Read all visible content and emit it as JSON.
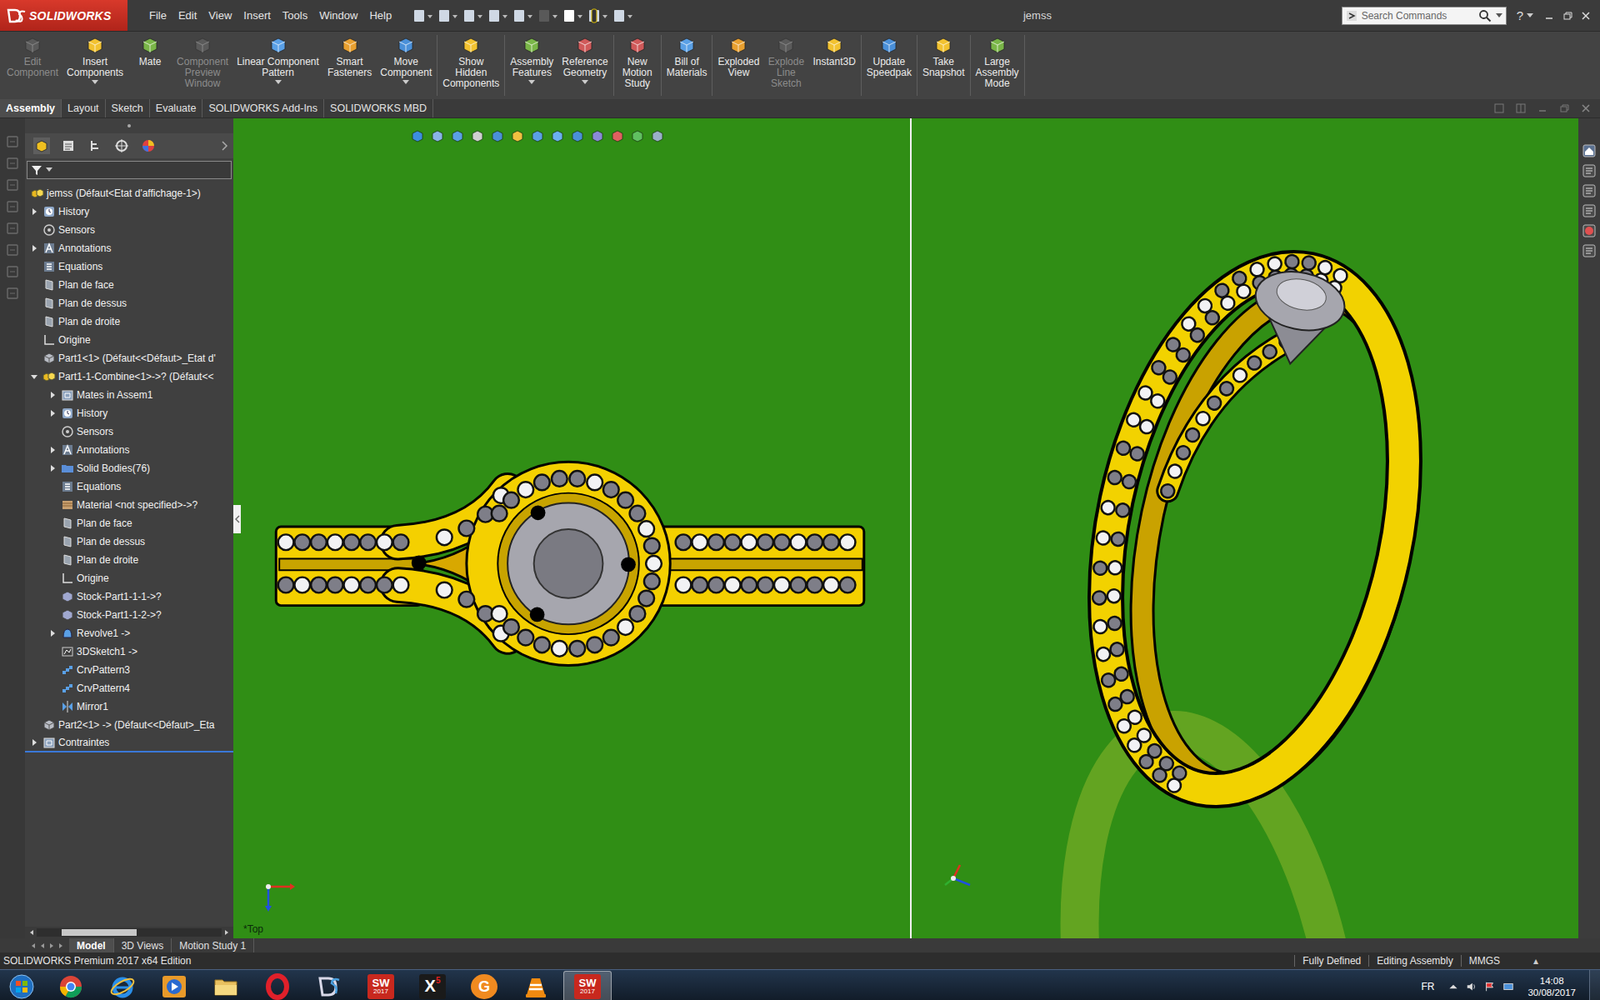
{
  "window": {
    "title": "jemss"
  },
  "brand": {
    "name": "SOLIDWORKS"
  },
  "menu": [
    "File",
    "Edit",
    "View",
    "Insert",
    "Tools",
    "Window",
    "Help"
  ],
  "search": {
    "placeholder": "Search Commands"
  },
  "help": {
    "label": "?"
  },
  "ribbon": {
    "groups": [
      [
        {
          "lines": [
            "Edit",
            "Component"
          ],
          "disabled": true,
          "dropdown": false
        },
        {
          "lines": [
            "Insert",
            "Components"
          ],
          "disabled": false,
          "dropdown": true
        },
        {
          "lines": [
            "Mate"
          ],
          "disabled": false,
          "dropdown": false
        },
        {
          "lines": [
            "Component",
            "Preview",
            "Window"
          ],
          "disabled": true,
          "dropdown": false
        },
        {
          "lines": [
            "Linear Component",
            "Pattern"
          ],
          "disabled": false,
          "dropdown": true
        },
        {
          "lines": [
            "Smart",
            "Fasteners"
          ],
          "disabled": false,
          "dropdown": false
        },
        {
          "lines": [
            "Move",
            "Component"
          ],
          "disabled": false,
          "dropdown": true
        }
      ],
      [
        {
          "lines": [
            "Show",
            "Hidden",
            "Components"
          ],
          "disabled": false,
          "dropdown": false
        }
      ],
      [
        {
          "lines": [
            "Assembly",
            "Features"
          ],
          "disabled": false,
          "dropdown": true
        },
        {
          "lines": [
            "Reference",
            "Geometry"
          ],
          "disabled": false,
          "dropdown": true
        }
      ],
      [
        {
          "lines": [
            "New",
            "Motion",
            "Study"
          ],
          "disabled": false,
          "dropdown": false
        }
      ],
      [
        {
          "lines": [
            "Bill of",
            "Materials"
          ],
          "disabled": false,
          "dropdown": false
        }
      ],
      [
        {
          "lines": [
            "Exploded",
            "View"
          ],
          "disabled": false,
          "dropdown": false
        },
        {
          "lines": [
            "Explode",
            "Line",
            "Sketch"
          ],
          "disabled": true,
          "dropdown": false
        },
        {
          "lines": [
            "Instant3D"
          ],
          "disabled": false,
          "dropdown": false
        }
      ],
      [
        {
          "lines": [
            "Update",
            "Speedpak"
          ],
          "disabled": false,
          "dropdown": false
        }
      ],
      [
        {
          "lines": [
            "Take",
            "Snapshot"
          ],
          "disabled": false,
          "dropdown": false
        }
      ],
      [
        {
          "lines": [
            "Large",
            "Assembly",
            "Mode"
          ],
          "disabled": false,
          "dropdown": false
        }
      ]
    ]
  },
  "tabs": [
    {
      "label": "Assembly",
      "selected": true
    },
    {
      "label": "Layout",
      "selected": false
    },
    {
      "label": "Sketch",
      "selected": false
    },
    {
      "label": "Evaluate",
      "selected": false
    },
    {
      "label": "SOLIDWORKS Add-Ins",
      "selected": false
    },
    {
      "label": "SOLIDWORKS MBD",
      "selected": false
    }
  ],
  "tree": {
    "items": [
      {
        "label": "jemss  (Défaut<Etat d'affichage-1>)",
        "depth": 0,
        "kind": "assembly",
        "expandable": false,
        "expanded": false,
        "selected": false
      },
      {
        "label": "History",
        "depth": 1,
        "kind": "history",
        "expandable": true,
        "expanded": false,
        "selected": false
      },
      {
        "label": "Sensors",
        "depth": 1,
        "kind": "sensor",
        "expandable": false,
        "expanded": false,
        "selected": false
      },
      {
        "label": "Annotations",
        "depth": 1,
        "kind": "annotation",
        "expandable": true,
        "expanded": false,
        "selected": false
      },
      {
        "label": "Equations",
        "depth": 1,
        "kind": "equation",
        "expandable": false,
        "expanded": false,
        "selected": false
      },
      {
        "label": "Plan de face",
        "depth": 1,
        "kind": "plane",
        "expandable": false,
        "expanded": false,
        "selected": false
      },
      {
        "label": "Plan de dessus",
        "depth": 1,
        "kind": "plane",
        "expandable": false,
        "expanded": false,
        "selected": false
      },
      {
        "label": "Plan de droite",
        "depth": 1,
        "kind": "plane",
        "expandable": false,
        "expanded": false,
        "selected": false
      },
      {
        "label": "Origine",
        "depth": 1,
        "kind": "origin",
        "expandable": false,
        "expanded": false,
        "selected": false
      },
      {
        "label": "Part1<1> (Défaut<<Défaut>_Etat d'",
        "depth": 1,
        "kind": "part",
        "expandable": false,
        "expanded": false,
        "selected": false
      },
      {
        "label": "Part1-1-Combine<1>->? (Défaut<<",
        "depth": 1,
        "kind": "assembly",
        "expandable": true,
        "expanded": true,
        "selected": false
      },
      {
        "label": "Mates in Assem1",
        "depth": 2,
        "kind": "mates",
        "expandable": true,
        "expanded": false,
        "selected": false
      },
      {
        "label": "History",
        "depth": 2,
        "kind": "history",
        "expandable": true,
        "expanded": false,
        "selected": false
      },
      {
        "label": "Sensors",
        "depth": 2,
        "kind": "sensor",
        "expandable": false,
        "expanded": false,
        "selected": false
      },
      {
        "label": "Annotations",
        "depth": 2,
        "kind": "annotation",
        "expandable": true,
        "expanded": false,
        "selected": false
      },
      {
        "label": "Solid Bodies(76)",
        "depth": 2,
        "kind": "bodies",
        "expandable": true,
        "expanded": false,
        "selected": false
      },
      {
        "label": "Equations",
        "depth": 2,
        "kind": "equation",
        "expandable": false,
        "expanded": false,
        "selected": false
      },
      {
        "label": "Material <not specified>->?",
        "depth": 2,
        "kind": "material",
        "expandable": false,
        "expanded": false,
        "selected": false
      },
      {
        "label": "Plan de face",
        "depth": 2,
        "kind": "plane",
        "expandable": false,
        "expanded": false,
        "selected": false
      },
      {
        "label": "Plan de dessus",
        "depth": 2,
        "kind": "plane",
        "expandable": false,
        "expanded": false,
        "selected": false
      },
      {
        "label": "Plan de droite",
        "depth": 2,
        "kind": "plane",
        "expandable": false,
        "expanded": false,
        "selected": false
      },
      {
        "label": "Origine",
        "depth": 2,
        "kind": "origin",
        "expandable": false,
        "expanded": false,
        "selected": false
      },
      {
        "label": "Stock-Part1-1-1->?",
        "depth": 2,
        "kind": "stock",
        "expandable": false,
        "expanded": false,
        "selected": false
      },
      {
        "label": "Stock-Part1-1-2->?",
        "depth": 2,
        "kind": "stock",
        "expandable": false,
        "expanded": false,
        "selected": false
      },
      {
        "label": "Revolve1 ->",
        "depth": 2,
        "kind": "revolve",
        "expandable": true,
        "expanded": false,
        "selected": false
      },
      {
        "label": "3DSketch1 ->",
        "depth": 2,
        "kind": "sketch",
        "expandable": false,
        "expanded": false,
        "selected": false
      },
      {
        "label": "CrvPattern3",
        "depth": 2,
        "kind": "pattern",
        "expandable": false,
        "expanded": false,
        "selected": false
      },
      {
        "label": "CrvPattern4",
        "depth": 2,
        "kind": "pattern",
        "expandable": false,
        "expanded": false,
        "selected": false
      },
      {
        "label": "Mirror1",
        "depth": 2,
        "kind": "mirror",
        "expandable": false,
        "expanded": false,
        "selected": false
      },
      {
        "label": "Part2<1> -> (Défaut<<Défaut>_Eta",
        "depth": 1,
        "kind": "part",
        "expandable": false,
        "expanded": false,
        "selected": false
      },
      {
        "label": "Contraintes",
        "depth": 1,
        "kind": "mates",
        "expandable": true,
        "expanded": false,
        "selected": true
      }
    ]
  },
  "viewport": {
    "view_label": "*Top"
  },
  "bottom_tabs": [
    {
      "label": "Model",
      "selected": true
    },
    {
      "label": "3D Views",
      "selected": false
    },
    {
      "label": "Motion Study 1",
      "selected": false
    }
  ],
  "status_bar": {
    "product": "SOLIDWORKS Premium 2017 x64 Edition",
    "items": [
      "Fully Defined",
      "Editing Assembly"
    ],
    "units": "MMGS",
    "units_menu": "▴"
  },
  "taskbar": {
    "apps": [
      {
        "kind": "start",
        "active": false
      },
      {
        "kind": "chrome",
        "active": false
      },
      {
        "kind": "ie",
        "active": false
      },
      {
        "kind": "media",
        "active": false
      },
      {
        "kind": "explorer",
        "active": false
      },
      {
        "kind": "opera",
        "active": false
      },
      {
        "kind": "ds",
        "active": false
      },
      {
        "kind": "solidworks",
        "mark": "SW",
        "badge": "2017",
        "active": false
      },
      {
        "kind": "corel",
        "mark": "X",
        "badge": "5",
        "active": false
      },
      {
        "kind": "pdf",
        "mark": "G",
        "active": false
      },
      {
        "kind": "vlc",
        "active": false
      },
      {
        "kind": "solidworks",
        "mark": "SW",
        "badge": "2017",
        "active": true
      }
    ],
    "language": "FR",
    "time": "14:08",
    "date": "30/08/2017"
  }
}
